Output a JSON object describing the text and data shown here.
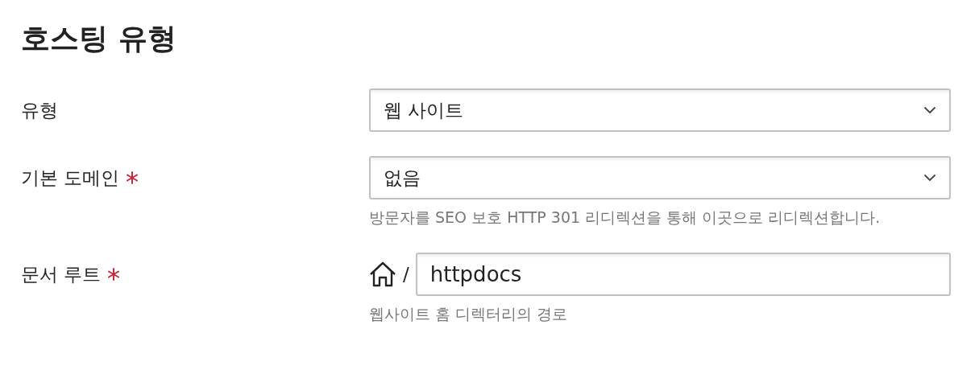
{
  "title": "호스팅 유형",
  "fields": [
    {
      "kind": "select",
      "label": "유형",
      "required": false,
      "value": "웹 사이트"
    },
    {
      "kind": "select",
      "label": "기본 도메인",
      "required": true,
      "value": "없음",
      "hint": "방문자를 SEO 보호 HTTP 301 리디렉션을 통해 이곳으로 리디렉션합니다."
    },
    {
      "kind": "path",
      "label": "문서 루트",
      "required": true,
      "prefix": "/",
      "value": "httpdocs",
      "hint": "웹사이트 홈 디렉터리의 경로"
    }
  ]
}
